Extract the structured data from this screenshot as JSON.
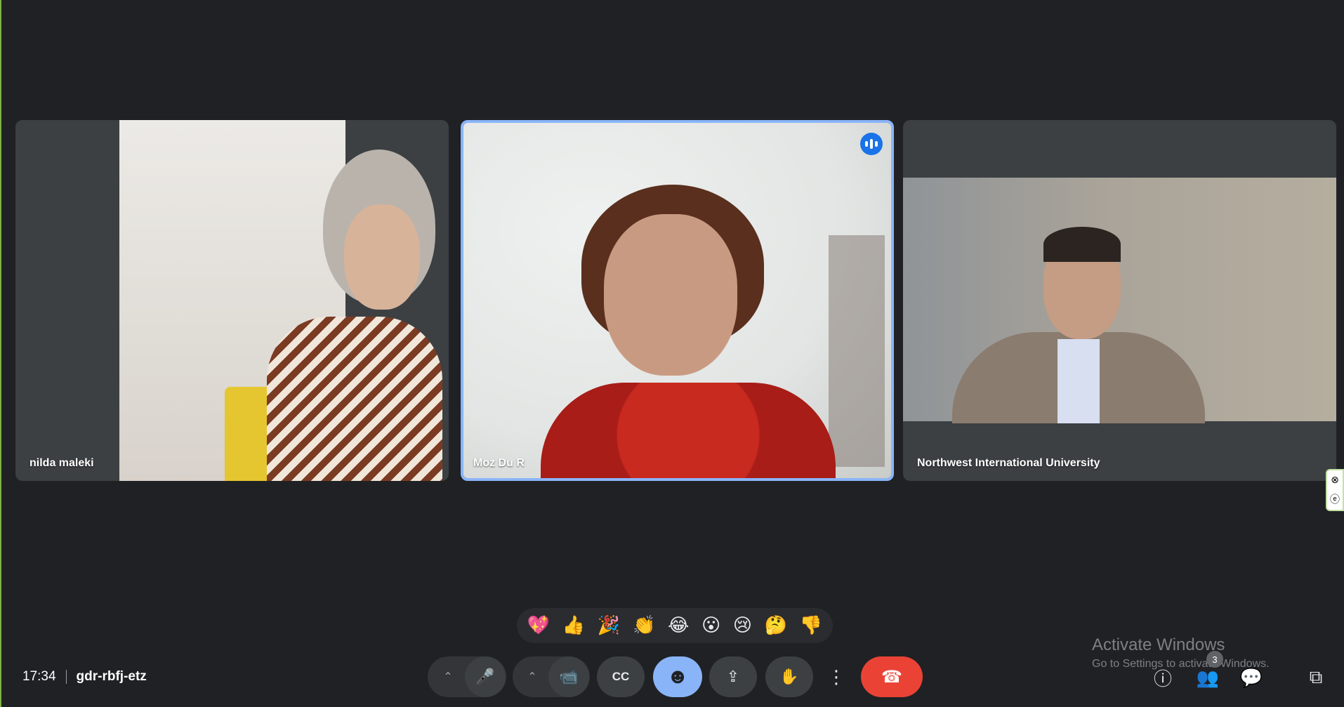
{
  "tiles": [
    {
      "name": "nilda maleki",
      "speaking": false
    },
    {
      "name": "Moz Du R",
      "speaking": true
    },
    {
      "name": "Northwest International University",
      "speaking": false
    }
  ],
  "reactions": [
    "💖",
    "👍",
    "🎉",
    "👏",
    "😂",
    "😮",
    "😢",
    "🤔",
    "👎"
  ],
  "meeting": {
    "time": "17:34",
    "code": "gdr-rbfj-etz"
  },
  "controls": {
    "mic_options": "⌃",
    "mic": "🎤",
    "camera_options": "⌃",
    "camera": "📹",
    "captions": "CC",
    "emoji": "☻",
    "present": "⇪",
    "raise_hand": "✋",
    "more": "⋮",
    "end_call": "☎"
  },
  "right_panel": {
    "info": "ⓘ",
    "people": "👥",
    "people_count": "3",
    "chat": "💬",
    "activities": "⧉"
  },
  "side_widget": {
    "close": "⊗",
    "edge": "ⓔ"
  },
  "watermark": {
    "title": "Activate Windows",
    "subtitle": "Go to Settings to activate Windows."
  },
  "colors": {
    "background": "#202124",
    "tile": "#3c4043",
    "active_border": "#8ab4f8",
    "end_call": "#ea4335",
    "speaking": "#1a73e8"
  }
}
